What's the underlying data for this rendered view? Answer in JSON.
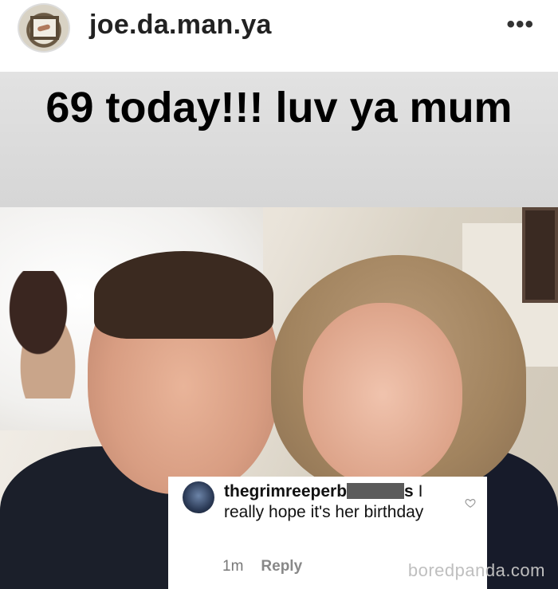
{
  "header": {
    "username": "joe.da.man.ya",
    "more_label": "•••"
  },
  "post": {
    "caption_overlay": "69 today!!! luv ya mum"
  },
  "comment": {
    "username_visible_start": "thegrimreeperb",
    "username_visible_end": "s",
    "text": "I really hope it's her birthday",
    "time": "1m",
    "reply_label": "Reply"
  },
  "watermark": "boredpanda.com",
  "icons": {
    "more": "more-options-icon",
    "heart": "heart-outline-icon"
  }
}
